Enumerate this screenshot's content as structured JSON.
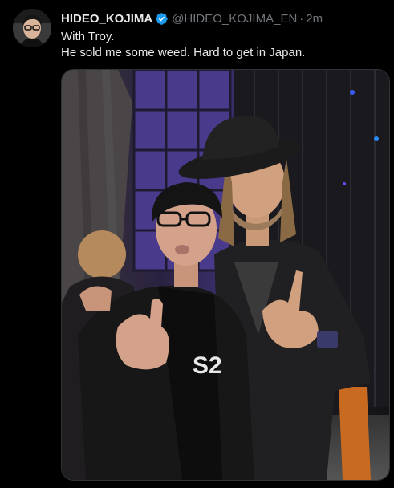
{
  "author": {
    "name": "HIDEO_KOJIMA",
    "handle": "@HIDEO_KOJIMA_EN",
    "time": "2m",
    "separator": "·",
    "verified": true,
    "avatar_icon": "avatar-photo"
  },
  "tweet": {
    "line1": "With Troy.",
    "line2": "He sold me some weed. Hard to get in Japan."
  },
  "media": {
    "shirt_text": "S2"
  },
  "colors": {
    "background": "#000000",
    "text": "#e7e9ea",
    "muted": "#71767b",
    "verified": "#1d9bf0"
  }
}
